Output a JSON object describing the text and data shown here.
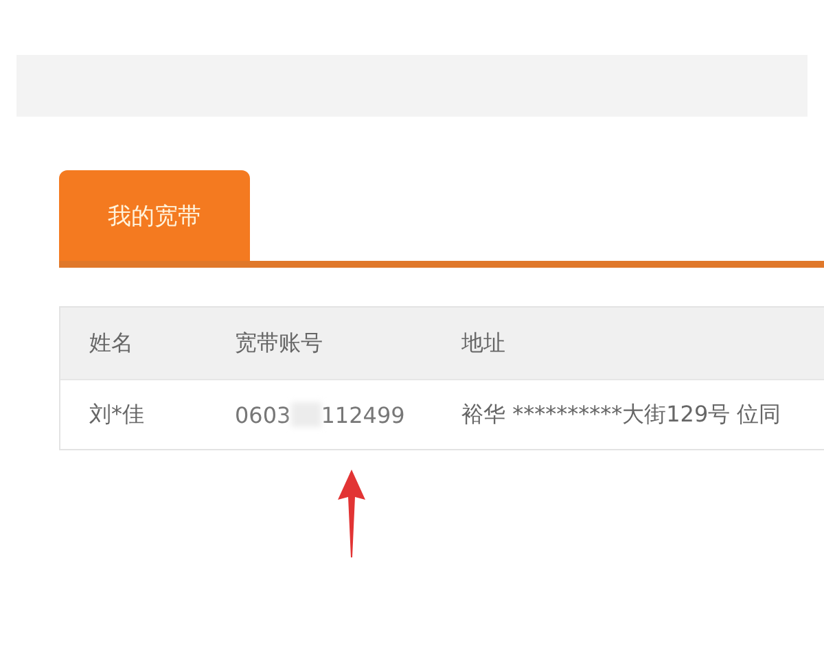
{
  "tabs": [
    {
      "label": "我的宽带",
      "selected": true
    }
  ],
  "table": {
    "columns": [
      "姓名",
      "宽带账号",
      "地址"
    ],
    "rows": [
      {
        "name": "刘*佳",
        "account_start": "0603",
        "account_masked": true,
        "account_end": "112499",
        "address": "裕华 **********大街129号 位同"
      }
    ]
  }
}
